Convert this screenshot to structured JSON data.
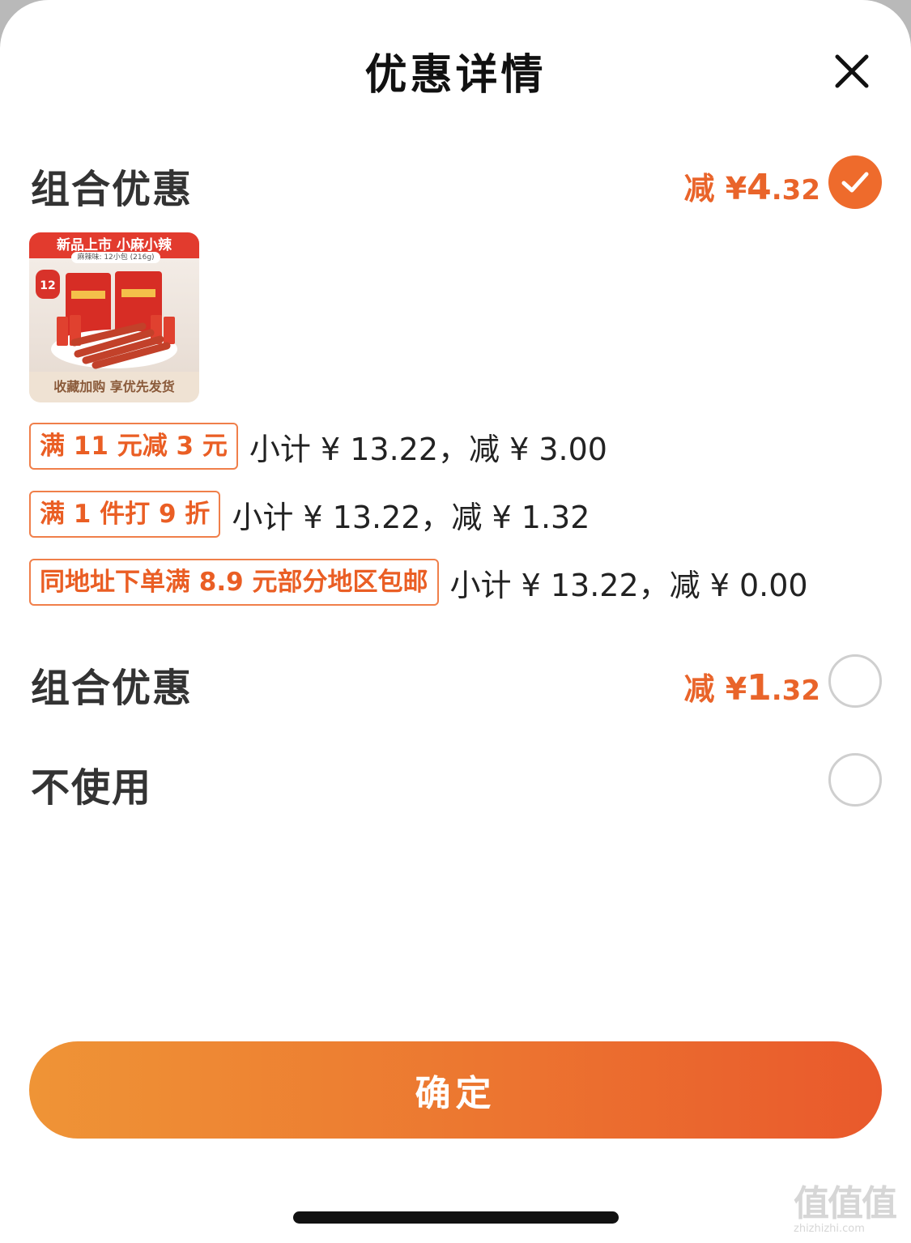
{
  "header": {
    "title": "优惠详情"
  },
  "options": [
    {
      "title": "组合优惠",
      "discount_label": "减 ¥ ",
      "discount_int": "4",
      "discount_dec": ".32",
      "selected": true
    },
    {
      "title": "组合优惠",
      "discount_label": "减 ¥ ",
      "discount_int": "1",
      "discount_dec": ".32",
      "selected": false
    },
    {
      "title": "不使用",
      "selected": false
    }
  ],
  "product": {
    "banner": "新品上市 小麻小辣",
    "subtitle": "麻辣味: 12小包 (216g)",
    "badge": "12",
    "footer": "收藏加购 享优先发货"
  },
  "promotions": [
    {
      "tag": "满 11 元减 3 元",
      "detail": "小计 ¥ 13.22，减 ¥ 3.00"
    },
    {
      "tag": "满 1 件打 9 折",
      "detail": "小计 ¥ 13.22，减 ¥ 1.32"
    },
    {
      "tag": "同地址下单满 8.9 元部分地区包邮",
      "detail": "小计 ¥ 13.22，减 ¥ 0.00"
    }
  ],
  "confirm_label": "确定",
  "watermark": {
    "chars": "值值值",
    "url": "zhizhizhi.com"
  },
  "colors": {
    "accent": "#ee6b2c",
    "tag_border": "#f07f4a",
    "tag_text": "#ea5e24",
    "button_start": "#ef9436",
    "button_end": "#e9592c"
  }
}
